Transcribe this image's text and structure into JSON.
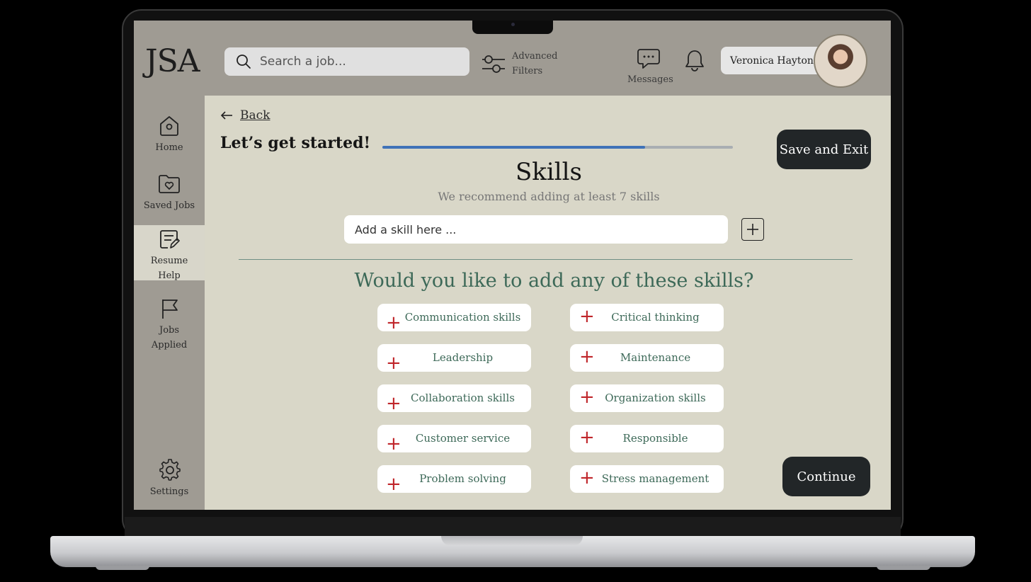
{
  "header": {
    "logo": "JSA",
    "search_placeholder": "Search a job...",
    "advanced_filters": "Advanced Filters",
    "messages_label": "Messages",
    "user_name": "Veronica Hayton"
  },
  "sidebar": {
    "items": [
      {
        "label": "Home",
        "icon": "home-icon"
      },
      {
        "label": "Saved Jobs",
        "icon": "saved-jobs-icon"
      },
      {
        "label": "Resume Help",
        "icon": "resume-icon",
        "active": true
      },
      {
        "label": "Jobs Applied",
        "icon": "flag-icon"
      },
      {
        "label": "Settings",
        "icon": "gear-icon"
      }
    ]
  },
  "main": {
    "back_label": "Back",
    "intro": "Let’s get started!",
    "progress": 0.75,
    "save_exit_label": "Save and Exit",
    "title": "Skills",
    "recommendation": "We recommend adding at least 7 skills",
    "skill_input_placeholder": "Add a skill here ...",
    "question": "Would you like to add any of these skills?",
    "suggested_skills": [
      "Communication skills",
      "Critical thinking",
      "Leadership",
      "Maintenance",
      "Collaboration skills",
      "Organization skills",
      "Customer service",
      "Responsible",
      "Problem solving",
      "Stress management"
    ],
    "continue_label": "Continue"
  },
  "colors": {
    "sidebar_bg": "#9f9b93",
    "main_bg": "#d9d7c8",
    "accent_green": "#3d6958",
    "plus_red": "#c0262b",
    "progress_blue": "#3f72b8",
    "button_dark": "#222628"
  }
}
